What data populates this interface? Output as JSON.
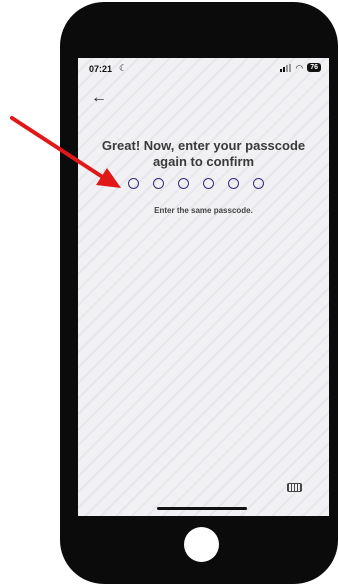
{
  "status_bar": {
    "time": "07:21",
    "moon_glyph": "☾",
    "wifi_glyph": "◠",
    "battery": "76"
  },
  "nav": {
    "back_glyph": "←"
  },
  "content": {
    "title": "Great! Now, enter your passcode again to confirm",
    "hint": "Enter the same passcode.",
    "pin_length": 6
  },
  "annotation": {
    "arrow_color": "#e01818"
  }
}
